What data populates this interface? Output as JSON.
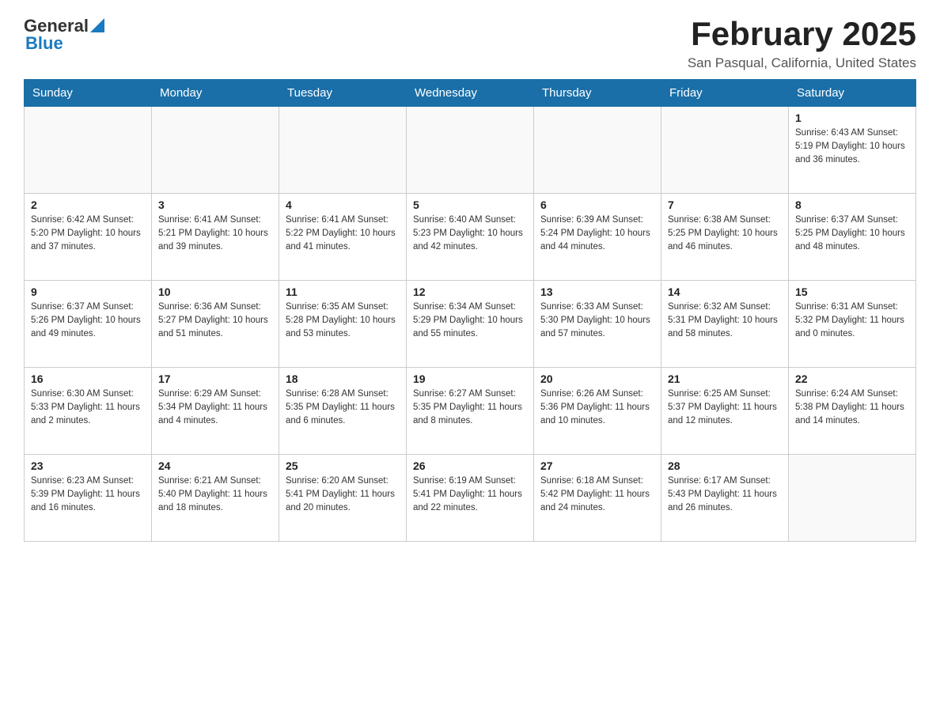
{
  "header": {
    "logo_general": "General",
    "logo_blue": "Blue",
    "month_title": "February 2025",
    "location": "San Pasqual, California, United States"
  },
  "calendar": {
    "days_of_week": [
      "Sunday",
      "Monday",
      "Tuesday",
      "Wednesday",
      "Thursday",
      "Friday",
      "Saturday"
    ],
    "weeks": [
      [
        {
          "day": "",
          "info": ""
        },
        {
          "day": "",
          "info": ""
        },
        {
          "day": "",
          "info": ""
        },
        {
          "day": "",
          "info": ""
        },
        {
          "day": "",
          "info": ""
        },
        {
          "day": "",
          "info": ""
        },
        {
          "day": "1",
          "info": "Sunrise: 6:43 AM\nSunset: 5:19 PM\nDaylight: 10 hours and 36 minutes."
        }
      ],
      [
        {
          "day": "2",
          "info": "Sunrise: 6:42 AM\nSunset: 5:20 PM\nDaylight: 10 hours and 37 minutes."
        },
        {
          "day": "3",
          "info": "Sunrise: 6:41 AM\nSunset: 5:21 PM\nDaylight: 10 hours and 39 minutes."
        },
        {
          "day": "4",
          "info": "Sunrise: 6:41 AM\nSunset: 5:22 PM\nDaylight: 10 hours and 41 minutes."
        },
        {
          "day": "5",
          "info": "Sunrise: 6:40 AM\nSunset: 5:23 PM\nDaylight: 10 hours and 42 minutes."
        },
        {
          "day": "6",
          "info": "Sunrise: 6:39 AM\nSunset: 5:24 PM\nDaylight: 10 hours and 44 minutes."
        },
        {
          "day": "7",
          "info": "Sunrise: 6:38 AM\nSunset: 5:25 PM\nDaylight: 10 hours and 46 minutes."
        },
        {
          "day": "8",
          "info": "Sunrise: 6:37 AM\nSunset: 5:25 PM\nDaylight: 10 hours and 48 minutes."
        }
      ],
      [
        {
          "day": "9",
          "info": "Sunrise: 6:37 AM\nSunset: 5:26 PM\nDaylight: 10 hours and 49 minutes."
        },
        {
          "day": "10",
          "info": "Sunrise: 6:36 AM\nSunset: 5:27 PM\nDaylight: 10 hours and 51 minutes."
        },
        {
          "day": "11",
          "info": "Sunrise: 6:35 AM\nSunset: 5:28 PM\nDaylight: 10 hours and 53 minutes."
        },
        {
          "day": "12",
          "info": "Sunrise: 6:34 AM\nSunset: 5:29 PM\nDaylight: 10 hours and 55 minutes."
        },
        {
          "day": "13",
          "info": "Sunrise: 6:33 AM\nSunset: 5:30 PM\nDaylight: 10 hours and 57 minutes."
        },
        {
          "day": "14",
          "info": "Sunrise: 6:32 AM\nSunset: 5:31 PM\nDaylight: 10 hours and 58 minutes."
        },
        {
          "day": "15",
          "info": "Sunrise: 6:31 AM\nSunset: 5:32 PM\nDaylight: 11 hours and 0 minutes."
        }
      ],
      [
        {
          "day": "16",
          "info": "Sunrise: 6:30 AM\nSunset: 5:33 PM\nDaylight: 11 hours and 2 minutes."
        },
        {
          "day": "17",
          "info": "Sunrise: 6:29 AM\nSunset: 5:34 PM\nDaylight: 11 hours and 4 minutes."
        },
        {
          "day": "18",
          "info": "Sunrise: 6:28 AM\nSunset: 5:35 PM\nDaylight: 11 hours and 6 minutes."
        },
        {
          "day": "19",
          "info": "Sunrise: 6:27 AM\nSunset: 5:35 PM\nDaylight: 11 hours and 8 minutes."
        },
        {
          "day": "20",
          "info": "Sunrise: 6:26 AM\nSunset: 5:36 PM\nDaylight: 11 hours and 10 minutes."
        },
        {
          "day": "21",
          "info": "Sunrise: 6:25 AM\nSunset: 5:37 PM\nDaylight: 11 hours and 12 minutes."
        },
        {
          "day": "22",
          "info": "Sunrise: 6:24 AM\nSunset: 5:38 PM\nDaylight: 11 hours and 14 minutes."
        }
      ],
      [
        {
          "day": "23",
          "info": "Sunrise: 6:23 AM\nSunset: 5:39 PM\nDaylight: 11 hours and 16 minutes."
        },
        {
          "day": "24",
          "info": "Sunrise: 6:21 AM\nSunset: 5:40 PM\nDaylight: 11 hours and 18 minutes."
        },
        {
          "day": "25",
          "info": "Sunrise: 6:20 AM\nSunset: 5:41 PM\nDaylight: 11 hours and 20 minutes."
        },
        {
          "day": "26",
          "info": "Sunrise: 6:19 AM\nSunset: 5:41 PM\nDaylight: 11 hours and 22 minutes."
        },
        {
          "day": "27",
          "info": "Sunrise: 6:18 AM\nSunset: 5:42 PM\nDaylight: 11 hours and 24 minutes."
        },
        {
          "day": "28",
          "info": "Sunrise: 6:17 AM\nSunset: 5:43 PM\nDaylight: 11 hours and 26 minutes."
        },
        {
          "day": "",
          "info": ""
        }
      ]
    ]
  }
}
